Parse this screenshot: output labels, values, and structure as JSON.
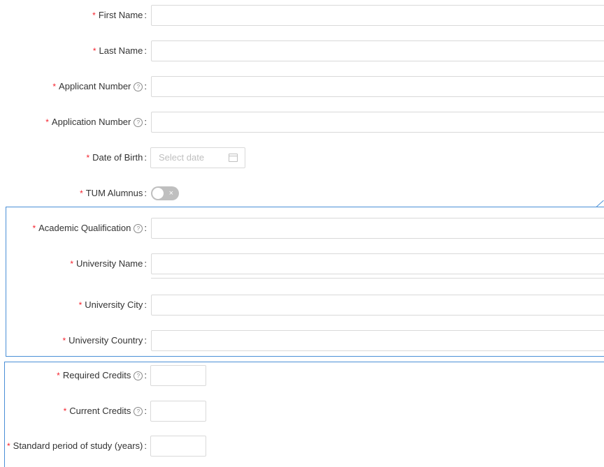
{
  "fields": {
    "first_name": {
      "label": "First Name"
    },
    "last_name": {
      "label": "Last Name"
    },
    "applicant_number": {
      "label": "Applicant Number"
    },
    "application_number": {
      "label": "Application Number"
    },
    "date_of_birth": {
      "label": "Date of Birth",
      "placeholder": "Select date"
    },
    "tum_alumnus": {
      "label": "TUM Alumnus",
      "toggle_state": "off",
      "toggle_glyph": "×"
    },
    "academic_qualification": {
      "label": "Academic Qualification"
    },
    "university_name": {
      "label": "University Name"
    },
    "university_city": {
      "label": "University City"
    },
    "university_country": {
      "label": "University Country"
    },
    "required_credits": {
      "label": "Required Credits"
    },
    "current_credits": {
      "label": "Current Credits"
    },
    "standard_period": {
      "label": "Standard period of study (years)"
    }
  },
  "common": {
    "required_mark": "*",
    "colon": ":",
    "help_glyph": "?"
  },
  "colors": {
    "required": "#f5222d",
    "section_border": "#4a8fd6",
    "input_border": "#d9d9d9"
  },
  "icons": {
    "help": "question-circle-icon",
    "calendar": "calendar-icon"
  }
}
